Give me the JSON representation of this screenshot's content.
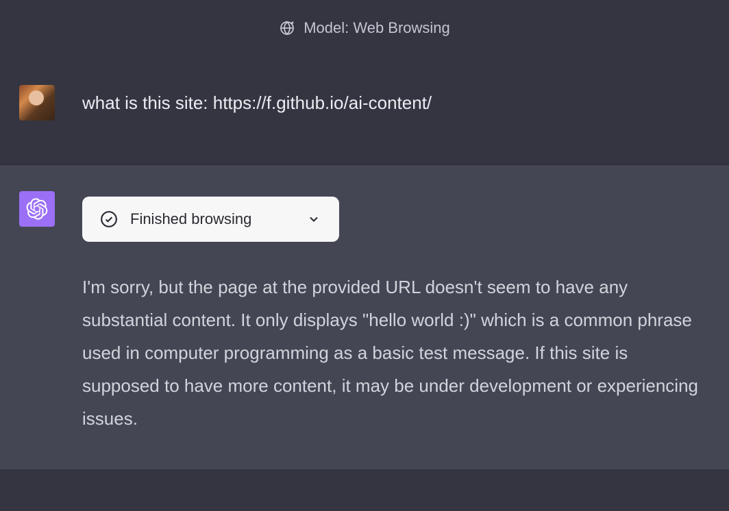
{
  "header": {
    "model_label": "Model: Web Browsing"
  },
  "user_message": {
    "text": "what is this site: https://f.github.io/ai-content/"
  },
  "assistant_message": {
    "badge_text": "Finished browsing",
    "response_text": "I'm sorry, but the page at the provided URL doesn't seem to have any substantial content. It only displays \"hello world :)\" which is a common phrase used in computer programming as a basic test message. If this site is supposed to have more content, it may be under development or experiencing issues."
  }
}
